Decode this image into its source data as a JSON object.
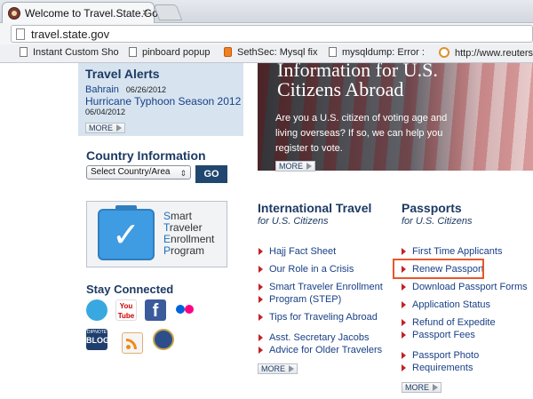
{
  "browser": {
    "tab_title": "Welcome to Travel.State.Gov",
    "close": "×",
    "url": "travel.state.gov",
    "bookmarks": [
      {
        "label": "Instant Custom Sho",
        "icon": "page-icon"
      },
      {
        "label": "pinboard popup",
        "icon": "page-icon"
      },
      {
        "label": "SethSec: Mysql fix",
        "icon": "blogger-icon"
      },
      {
        "label": "mysqldump: Error :",
        "icon": "page-icon"
      },
      {
        "label": "http://www.reuters",
        "icon": "reuters-icon"
      }
    ]
  },
  "alerts": {
    "heading": "Travel Alerts",
    "item1": "Bahrain",
    "item1_date": "06/26/2012",
    "item2": "Hurricane Typhoon Season 2012",
    "item2_date": "06/04/2012",
    "more": "MORE"
  },
  "country": {
    "heading": "Country Information",
    "select": "Select Country/Area",
    "go": "GO"
  },
  "stp": {
    "line1_cap": "S",
    "line1_rest": "mart",
    "line2_cap": "T",
    "line2_rest": "raveler",
    "line3_cap": "E",
    "line3_rest": "nrollment",
    "line4_cap": "P",
    "line4_rest": "rogram"
  },
  "stay_connected": {
    "heading": "Stay Connected",
    "icons": [
      "twitter-icon",
      "youtube-icon",
      "facebook-icon",
      "flickr-icon",
      "dipnote-blog-icon",
      "rss-icon",
      "state-seal-icon"
    ],
    "youtube_text": "You Tube",
    "blog_top": "DIPNOTE",
    "blog_main": "BLOG"
  },
  "hero": {
    "line1": "Information for U.S.",
    "line2": "Citizens Abroad",
    "body": "Are you a U.S. citizen of voting age and living overseas? If so, we can help you register to vote.",
    "more": "MORE"
  },
  "intl_travel": {
    "heading": "International Travel",
    "sub": "for U.S. Citizens",
    "links": [
      "Hajj Fact Sheet",
      "Our Role in a Crisis",
      "Smart Traveler Enrollment",
      "Program (STEP)",
      "Tips for Traveling Abroad",
      "Asst. Secretary Jacobs",
      "Advice for Older Travelers"
    ],
    "more": "MORE"
  },
  "passports": {
    "heading": "Passports",
    "sub": "for U.S. Citizens",
    "links": [
      "First Time Applicants",
      "Renew Passport",
      "Download Passport Forms",
      "Application Status",
      "Refund of Expedite",
      "Passport Fees",
      "Passport Photo",
      "Requirements"
    ],
    "more": "MORE"
  }
}
